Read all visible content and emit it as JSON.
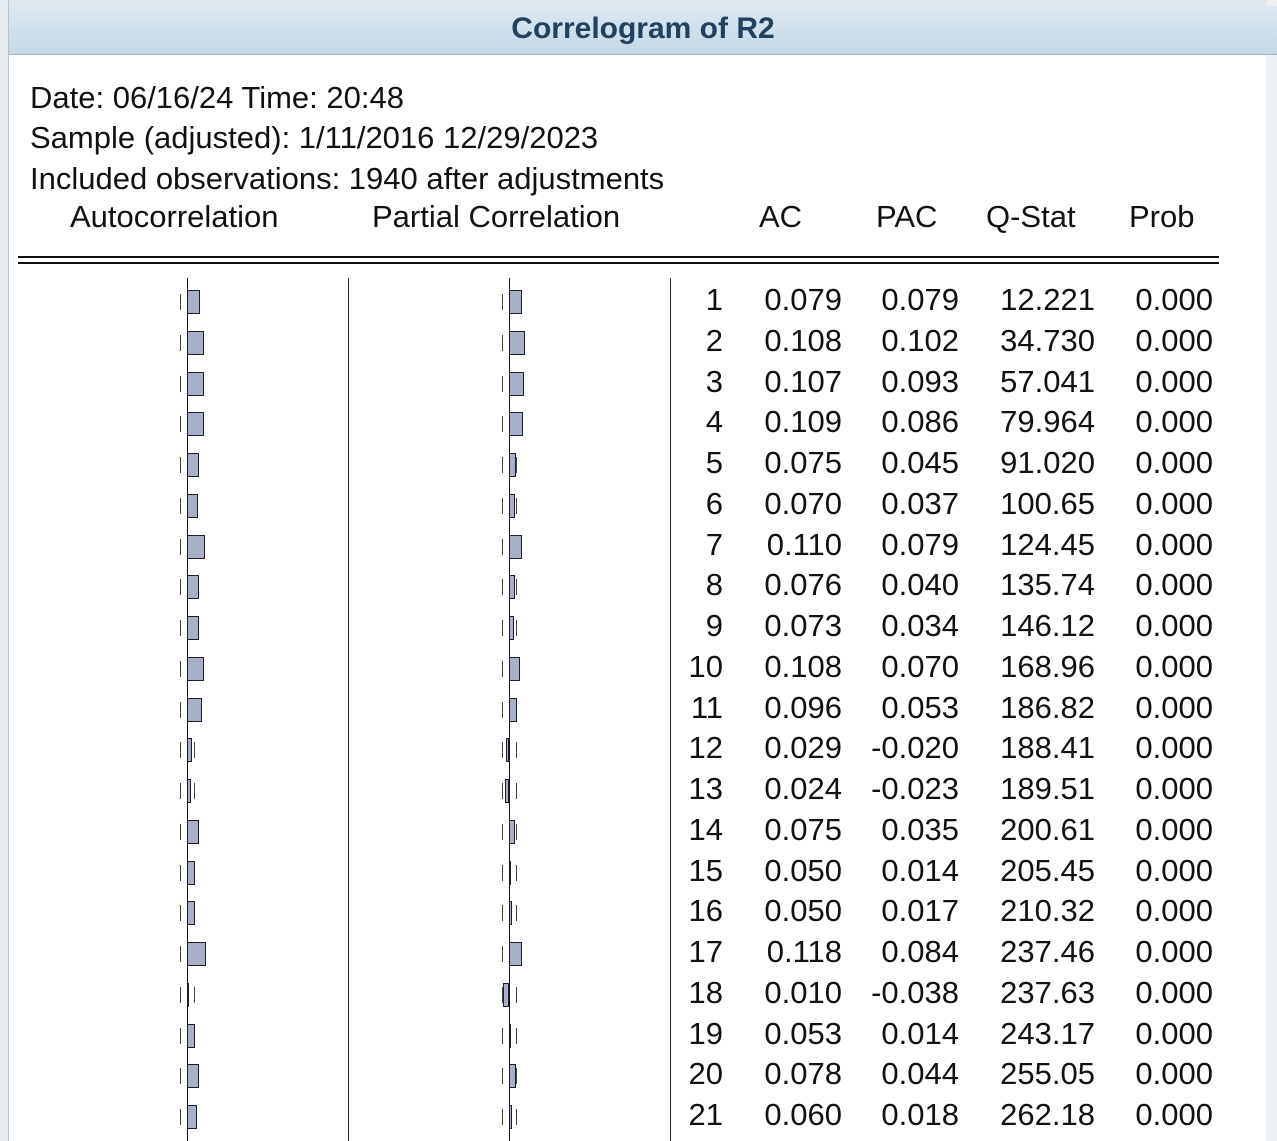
{
  "window": {
    "title": "Correlogram of R2"
  },
  "header": {
    "line1": "Date: 06/16/24   Time: 20:48",
    "line2": "Sample (adjusted): 1/11/2016 12/29/2023",
    "line3": "Included observations: 1940 after adjustments"
  },
  "columns": {
    "autocorrelation": "Autocorrelation",
    "partial_correlation": "Partial Correlation",
    "ac": "AC",
    "pac": "PAC",
    "qstat": "Q-Stat",
    "prob": "Prob"
  },
  "rows": [
    {
      "lag": "1",
      "ac": "0.079",
      "pac": "0.079",
      "q": "12.221",
      "p": "0.000"
    },
    {
      "lag": "2",
      "ac": "0.108",
      "pac": "0.102",
      "q": "34.730",
      "p": "0.000"
    },
    {
      "lag": "3",
      "ac": "0.107",
      "pac": "0.093",
      "q": "57.041",
      "p": "0.000"
    },
    {
      "lag": "4",
      "ac": "0.109",
      "pac": "0.086",
      "q": "79.964",
      "p": "0.000"
    },
    {
      "lag": "5",
      "ac": "0.075",
      "pac": "0.045",
      "q": "91.020",
      "p": "0.000"
    },
    {
      "lag": "6",
      "ac": "0.070",
      "pac": "0.037",
      "q": "100.65",
      "p": "0.000"
    },
    {
      "lag": "7",
      "ac": "0.110",
      "pac": "0.079",
      "q": "124.45",
      "p": "0.000"
    },
    {
      "lag": "8",
      "ac": "0.076",
      "pac": "0.040",
      "q": "135.74",
      "p": "0.000"
    },
    {
      "lag": "9",
      "ac": "0.073",
      "pac": "0.034",
      "q": "146.12",
      "p": "0.000"
    },
    {
      "lag": "10",
      "ac": "0.108",
      "pac": "0.070",
      "q": "168.96",
      "p": "0.000"
    },
    {
      "lag": "11",
      "ac": "0.096",
      "pac": "0.053",
      "q": "186.82",
      "p": "0.000"
    },
    {
      "lag": "12",
      "ac": "0.029",
      "pac": "-0.020",
      "q": "188.41",
      "p": "0.000"
    },
    {
      "lag": "13",
      "ac": "0.024",
      "pac": "-0.023",
      "q": "189.51",
      "p": "0.000"
    },
    {
      "lag": "14",
      "ac": "0.075",
      "pac": "0.035",
      "q": "200.61",
      "p": "0.000"
    },
    {
      "lag": "15",
      "ac": "0.050",
      "pac": "0.014",
      "q": "205.45",
      "p": "0.000"
    },
    {
      "lag": "16",
      "ac": "0.050",
      "pac": "0.017",
      "q": "210.32",
      "p": "0.000"
    },
    {
      "lag": "17",
      "ac": "0.118",
      "pac": "0.084",
      "q": "237.46",
      "p": "0.000"
    },
    {
      "lag": "18",
      "ac": "0.010",
      "pac": "-0.038",
      "q": "237.63",
      "p": "0.000"
    },
    {
      "lag": "19",
      "ac": "0.053",
      "pac": "0.014",
      "q": "243.17",
      "p": "0.000"
    },
    {
      "lag": "20",
      "ac": "0.078",
      "pac": "0.044",
      "q": "255.05",
      "p": "0.000"
    },
    {
      "lag": "21",
      "ac": "0.060",
      "pac": "0.018",
      "q": "262.18",
      "p": "0.000"
    }
  ],
  "colors": {
    "bar_fill": "#a8b0c8",
    "bar_border": "#1d1d2c",
    "titlebar_text": "#21415e"
  }
}
